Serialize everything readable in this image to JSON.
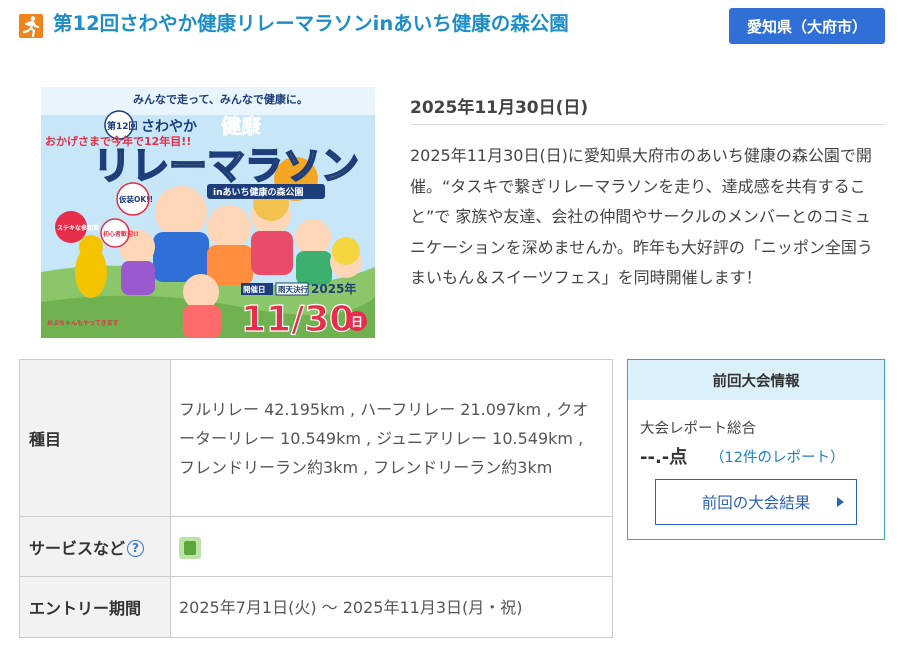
{
  "event": {
    "icon": "running-person-icon",
    "title": "第12回さわやか健康リレーマラソンinあいち健康の森公園",
    "prefecture_button": "愛知県（大府市）",
    "date_heading": "2025年11月30日(日)",
    "description": "2025年11月30日(日)に愛知県大府市のあいち健康の森公園で開催。“タスキで繋ぎリレーマラソンを走り、達成感を共有すること”で 家族や友達、会社の仲間やサークルのメンバーとのコミュニケーションを深めませんか。昨年も大好評の「ニッポン全国うまいもん＆スイーツフェス」を同時開催します！"
  },
  "poster": {
    "top_caption": "みんなで走って、みんなで健康に。",
    "edition": "第12回",
    "subtitle_small": "さわやか",
    "subtitle_kanji": "健康",
    "main_title": "リレーマラソン",
    "venue": "inあいち健康の森公園",
    "left_caption": "おかげさまで今年で12年目!!",
    "costume_badge": "仮装OK!!",
    "beginner_badge": "初心者歓迎!!",
    "prize_badge": "ステキな参加賞",
    "mascot_caption": "おぶちゃんもやってきます",
    "date_label": "開催日",
    "rain_label": "雨天決行",
    "year": "2025年",
    "big_date": "11/30",
    "day": "日"
  },
  "details": {
    "rows": [
      {
        "label": "種目",
        "value": "フルリレー 42.195km , ハーフリレー 21.097km , クオーターリレー 10.549km , ジュニアリレー 10.549km , フレンドリーラン約3km , フレンドリーラン約3km"
      },
      {
        "label": "サービスなど",
        "help_icon": "?",
        "value_icon": "service-icon"
      },
      {
        "label": "エントリー期間",
        "value": "2025年7月1日(火) ～ 2025年11月3日(月・祝)"
      }
    ]
  },
  "previous": {
    "heading": "前回大会情報",
    "label": "大会レポート総合",
    "score": "--.-点",
    "reports": "（12件のレポート）",
    "button": "前回の大会結果"
  },
  "colors": {
    "title": "#1e8ec8",
    "accent_button": "#2f6fd6",
    "icon_bg": "#f0841c",
    "prev_border": "#3aa0c7"
  }
}
